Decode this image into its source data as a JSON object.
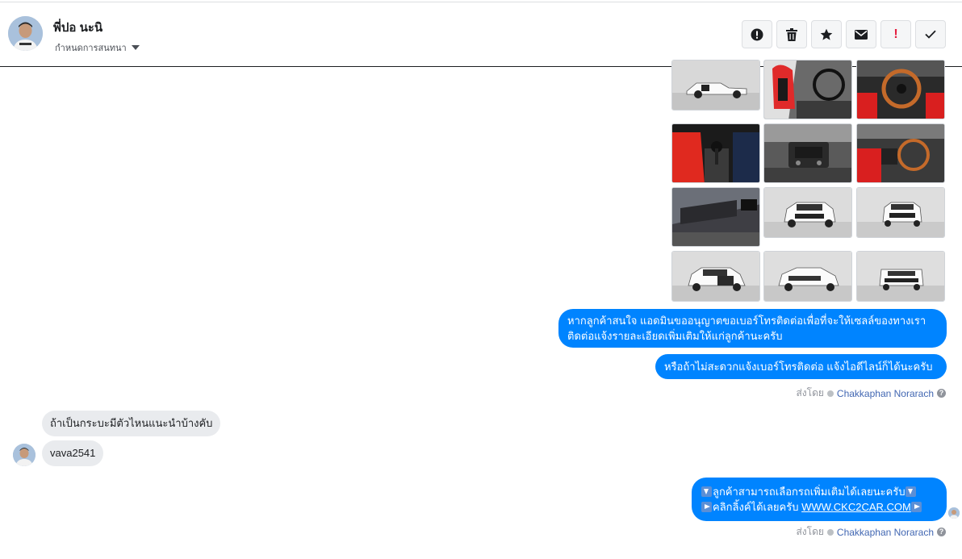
{
  "header": {
    "contact_name": "พี่ปอ นะนิ",
    "conversation_settings": "กำหนดการสนทนา",
    "actions": [
      {
        "name": "mark-spam-button",
        "icon": "alert-circle-icon"
      },
      {
        "name": "delete-button",
        "icon": "trash-icon"
      },
      {
        "name": "star-button",
        "icon": "star-icon"
      },
      {
        "name": "mark-unread-button",
        "icon": "envelope-icon"
      },
      {
        "name": "follow-up-button",
        "icon": "exclamation-icon"
      },
      {
        "name": "mark-done-button",
        "icon": "checkmark-icon"
      }
    ]
  },
  "messages": {
    "outgoing_1": "หากลูกค้าสนใจ แอดมินขออนุญาตขอเบอร์โทรติดต่อเพื่อที่จะให้เซลล์ของทางเรา",
    "outgoing_1_line2": "ติดต่อแจ้งรายละเอียดเพิ่มเติมให้แก่ลูกค้านะครับ",
    "outgoing_2": "หรือถ้าไม่สะดวกแจ้งเบอร์โทรติดต่อ แจ้งไอดีไลน์ก็ได้นะครับ",
    "sent_by_label": "ส่งโดย",
    "agent_name": "Chakkaphan Norarach",
    "help": "?",
    "incoming_1": "ถ้าเป็นกระบะมีตัวไหนแนะนำบ้างคับ",
    "incoming_2": "vava2541",
    "outgoing_3_line1": "ลูกค้าสามารถเลือกรถเพิ่มเติมได้เลยนะครับ",
    "outgoing_3_line2": "คลิกลิ้งค์ได้เลยครับ ",
    "link_text": "WWW.CKC2CAR.COM"
  },
  "colors": {
    "outgoing_bubble": "#0084ff",
    "incoming_bubble": "#e9ebee",
    "agent_link": "#4267b2"
  }
}
